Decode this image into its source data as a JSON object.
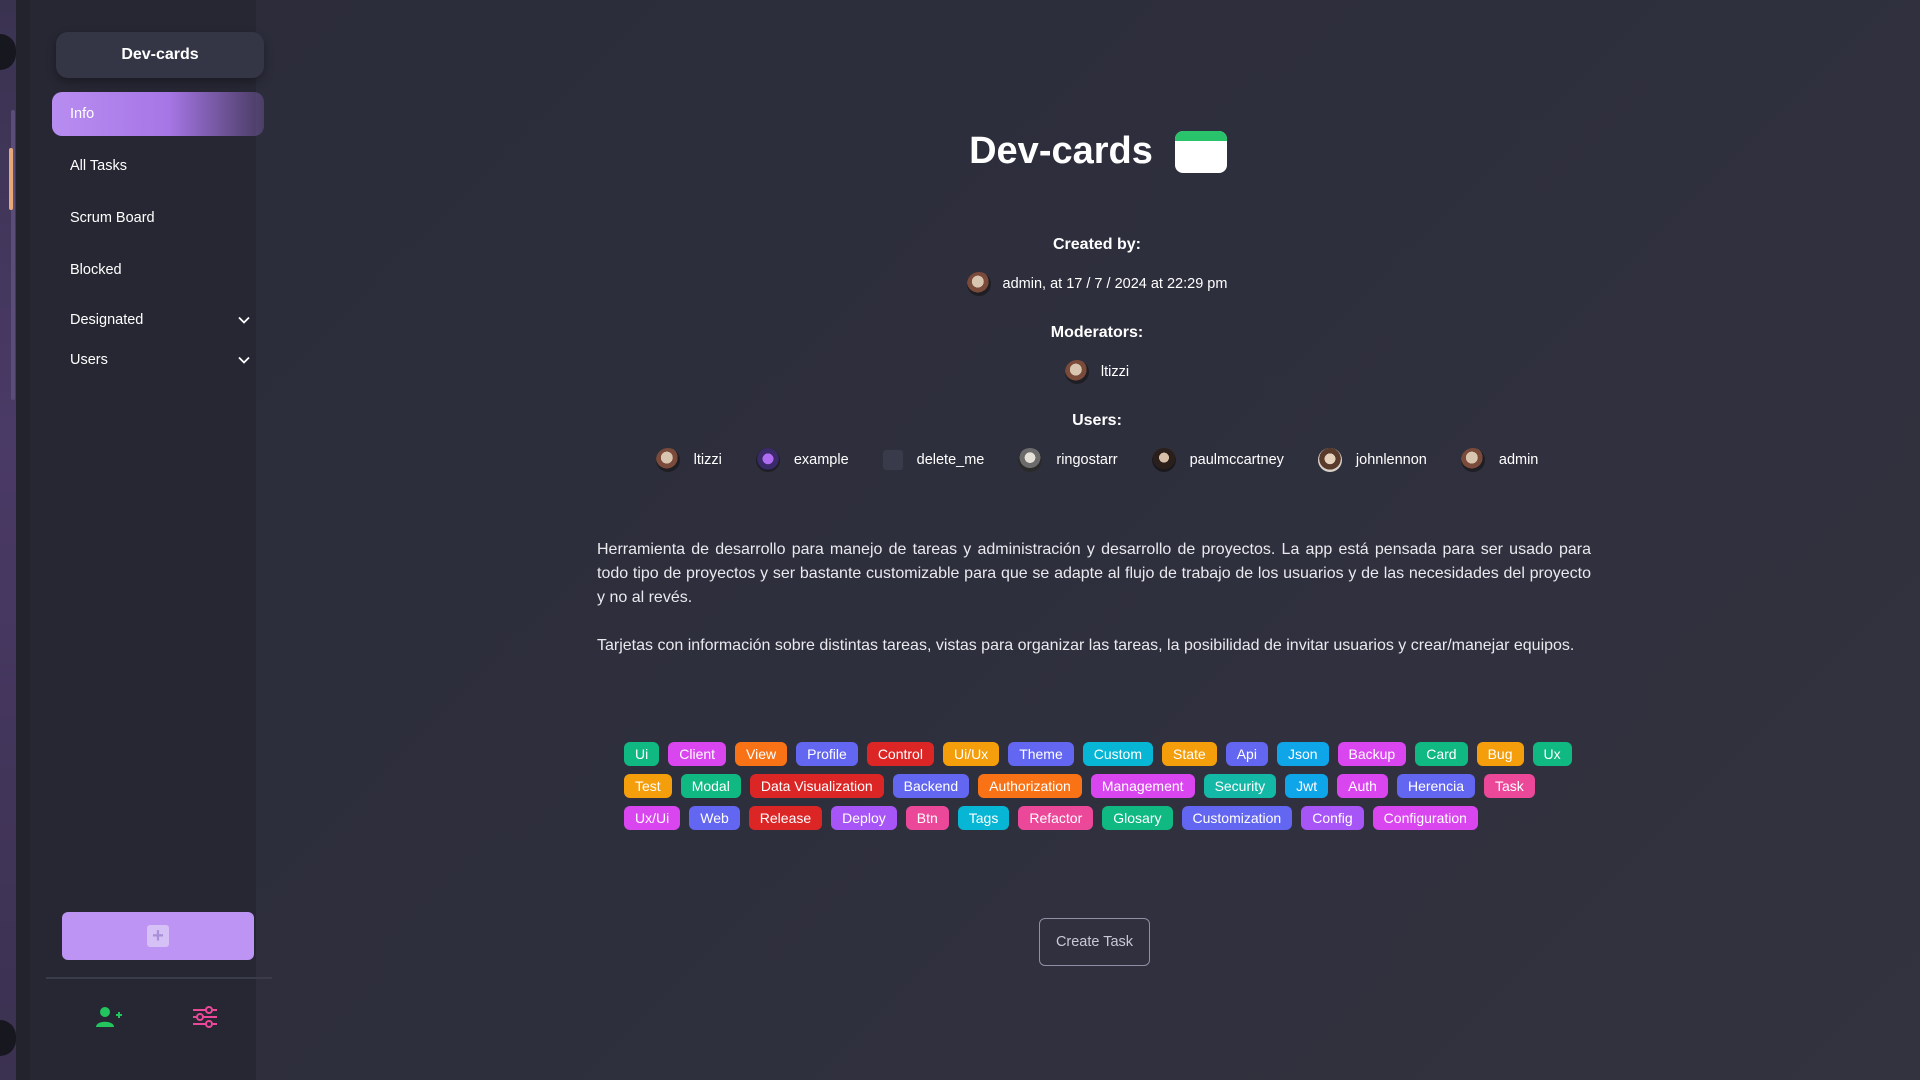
{
  "sidebar": {
    "project_name": "Dev-cards",
    "items": [
      {
        "label": "Info"
      },
      {
        "label": "All Tasks"
      },
      {
        "label": "Scrum Board"
      },
      {
        "label": "Blocked"
      },
      {
        "label": "Designated"
      },
      {
        "label": "Users"
      }
    ],
    "add_button_icon": "plus-icon",
    "footer_icons": [
      "add-user-icon",
      "settings-sliders-icon"
    ],
    "accent_color": "#bd93f3"
  },
  "main": {
    "title": "Dev-cards",
    "title_icon": "calendar-icon",
    "created_by_heading": "Created by:",
    "created_by_text": "admin, at 17 / 7 / 2024 at 22:29 pm",
    "moderators_heading": "Moderators:",
    "moderators": [
      {
        "name": "ltizzi"
      }
    ],
    "users_heading": "Users:",
    "users": [
      {
        "name": "ltizzi"
      },
      {
        "name": "example"
      },
      {
        "name": "delete_me"
      },
      {
        "name": "ringostarr"
      },
      {
        "name": "paulmccartney"
      },
      {
        "name": "johnlennon"
      },
      {
        "name": "admin"
      }
    ],
    "description_1": "Herramienta de desarrollo para manejo de tareas y administración y desarrollo de proyectos. La app está pensada para ser usado para todo tipo de proyectos y ser bastante customizable para que se adapte al flujo de trabajo de los usuarios y de las necesidades del proyecto y no al revés.",
    "description_2": "Tarjetas con información sobre distintas tareas, vistas para organizar las tareas, la posibilidad de invitar usuarios y crear/manejar equipos.",
    "tags": [
      {
        "label": "Ui",
        "color": "#10b981"
      },
      {
        "label": "Client",
        "color": "#d946ef"
      },
      {
        "label": "View",
        "color": "#f97316"
      },
      {
        "label": "Profile",
        "color": "#6366f1"
      },
      {
        "label": "Control",
        "color": "#dc2626"
      },
      {
        "label": "Ui/Ux",
        "color": "#f59e0b"
      },
      {
        "label": "Theme",
        "color": "#6366f1"
      },
      {
        "label": "Custom",
        "color": "#06b6d4"
      },
      {
        "label": "State",
        "color": "#f59e0b"
      },
      {
        "label": "Api",
        "color": "#6366f1"
      },
      {
        "label": "Json",
        "color": "#0ea5e9"
      },
      {
        "label": "Backup",
        "color": "#d946ef"
      },
      {
        "label": "Card",
        "color": "#10b981"
      },
      {
        "label": "Bug",
        "color": "#f59e0b"
      },
      {
        "label": "Ux",
        "color": "#10b981"
      },
      {
        "label": "Test",
        "color": "#f59e0b"
      },
      {
        "label": "Modal",
        "color": "#10b981"
      },
      {
        "label": "Data Visualization",
        "color": "#dc2626"
      },
      {
        "label": "Backend",
        "color": "#6366f1"
      },
      {
        "label": "Authorization",
        "color": "#f97316"
      },
      {
        "label": "Management",
        "color": "#d946ef"
      },
      {
        "label": "Security",
        "color": "#14b8a6"
      },
      {
        "label": "Jwt",
        "color": "#0ea5e9"
      },
      {
        "label": "Auth",
        "color": "#d946ef"
      },
      {
        "label": "Herencia",
        "color": "#6366f1"
      },
      {
        "label": "Task",
        "color": "#ec4899"
      },
      {
        "label": "Ux/Ui",
        "color": "#d946ef"
      },
      {
        "label": "Web",
        "color": "#6366f1"
      },
      {
        "label": "Release",
        "color": "#dc2626"
      },
      {
        "label": "Deploy",
        "color": "#a855f7"
      },
      {
        "label": "Btn",
        "color": "#ec4899"
      },
      {
        "label": "Tags",
        "color": "#06b6d4"
      },
      {
        "label": "Refactor",
        "color": "#ec4899"
      },
      {
        "label": "Glosary",
        "color": "#10b981"
      },
      {
        "label": "Customization",
        "color": "#6366f1"
      },
      {
        "label": "Config",
        "color": "#a855f7"
      },
      {
        "label": "Configuration",
        "color": "#d946ef"
      }
    ],
    "create_task_label": "Create Task"
  }
}
